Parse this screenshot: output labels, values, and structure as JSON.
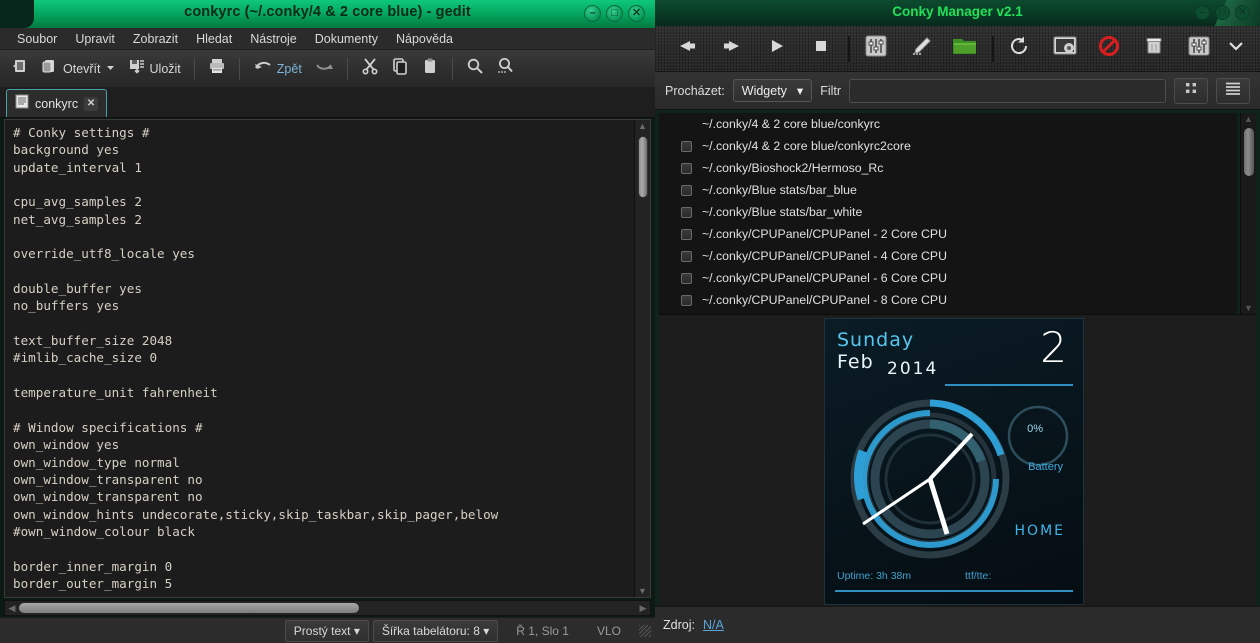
{
  "gedit": {
    "title": "conkyrc (~/.conky/4 & 2 core blue) - gedit",
    "window_controls": {
      "minimize": "–",
      "maximize": "□",
      "close": "✕"
    },
    "menu": [
      "Soubor",
      "Upravit",
      "Zobrazit",
      "Hledat",
      "Nástroje",
      "Dokumenty",
      "Nápověda"
    ],
    "toolbar": {
      "new_label": "",
      "open_label": "Otevřít",
      "save_label": "Uložit",
      "print_label": "",
      "undo_label": "Zpět",
      "redo_label": "",
      "cut_label": "",
      "copy_label": "",
      "paste_label": "",
      "find_label": "",
      "replace_label": ""
    },
    "tab": {
      "label": "conkyrc",
      "close": "✕"
    },
    "content": "# Conky settings #\nbackground yes\nupdate_interval 1\n\ncpu_avg_samples 2\nnet_avg_samples 2\n\noverride_utf8_locale yes\n\ndouble_buffer yes\nno_buffers yes\n\ntext_buffer_size 2048\n#imlib_cache_size 0\n\ntemperature_unit fahrenheit\n\n# Window specifications #\nown_window yes\nown_window_type normal\nown_window_transparent no\nown_window_transparent no\nown_window_hints undecorate,sticky,skip_taskbar,skip_pager,below\n#own_window_colour black\n\nborder_inner_margin 0\nborder_outer_margin 5",
    "status": {
      "language": "Prostý text",
      "tab_width": "Šířka tabelátoru: 8",
      "cursor": "Ř 1, Slo 1",
      "insert_mode": "VLO",
      "dropdown_arrow": "▾"
    }
  },
  "conky_manager": {
    "title": "Conky Manager v2.1",
    "window_controls": {
      "minimize": "–",
      "maximize": "□",
      "close": "✕"
    },
    "toolbar_icons": [
      "arrow-left-icon",
      "arrow-right-icon",
      "play-icon",
      "stop-icon",
      "sliders-icon",
      "pencil-icon",
      "folder-open-icon",
      "refresh-icon",
      "desktop-settings-icon",
      "forbidden-icon",
      "trash-icon",
      "sliders-menu-icon",
      "chevron-down-icon"
    ],
    "browse": {
      "label": "Procházet:",
      "selected": "Widgety",
      "dropdown_arrow": "▾",
      "filter_label": "Filtr",
      "filter_value": "",
      "filter_placeholder": ""
    },
    "view_buttons": [
      "grid-view-icon",
      "list-view-icon"
    ],
    "list": [
      {
        "path": "~/.conky/4 & 2 core blue/conkyrc",
        "checked": false,
        "checkbox_visible": false
      },
      {
        "path": "~/.conky/4 & 2 core blue/conkyrc2core",
        "checked": false,
        "checkbox_visible": true
      },
      {
        "path": "~/.conky/Bioshock2/Hermoso_Rc",
        "checked": false,
        "checkbox_visible": true
      },
      {
        "path": "~/.conky/Blue stats/bar_blue",
        "checked": false,
        "checkbox_visible": true
      },
      {
        "path": "~/.conky/Blue stats/bar_white",
        "checked": false,
        "checkbox_visible": true
      },
      {
        "path": "~/.conky/CPUPanel/CPUPanel - 2 Core CPU",
        "checked": false,
        "checkbox_visible": true
      },
      {
        "path": "~/.conky/CPUPanel/CPUPanel - 4 Core CPU",
        "checked": false,
        "checkbox_visible": true
      },
      {
        "path": "~/.conky/CPUPanel/CPUPanel - 6 Core CPU",
        "checked": false,
        "checkbox_visible": true
      },
      {
        "path": "~/.conky/CPUPanel/CPUPanel - 8 Core CPU",
        "checked": false,
        "checkbox_visible": true
      }
    ],
    "preview": {
      "day": "Sunday",
      "month": "Feb",
      "year": "2014",
      "date_number": "2",
      "battery_percent": "0%",
      "battery_label": "Battery",
      "network_label": "HOME",
      "uptime": "Uptime: 3h 38m",
      "transfer": "ttf/tte:",
      "accent_color": "#2e9fd4",
      "bg_color": "#07131a"
    },
    "status": {
      "source_label": "Zdroj:",
      "source_value": "N/A"
    }
  }
}
